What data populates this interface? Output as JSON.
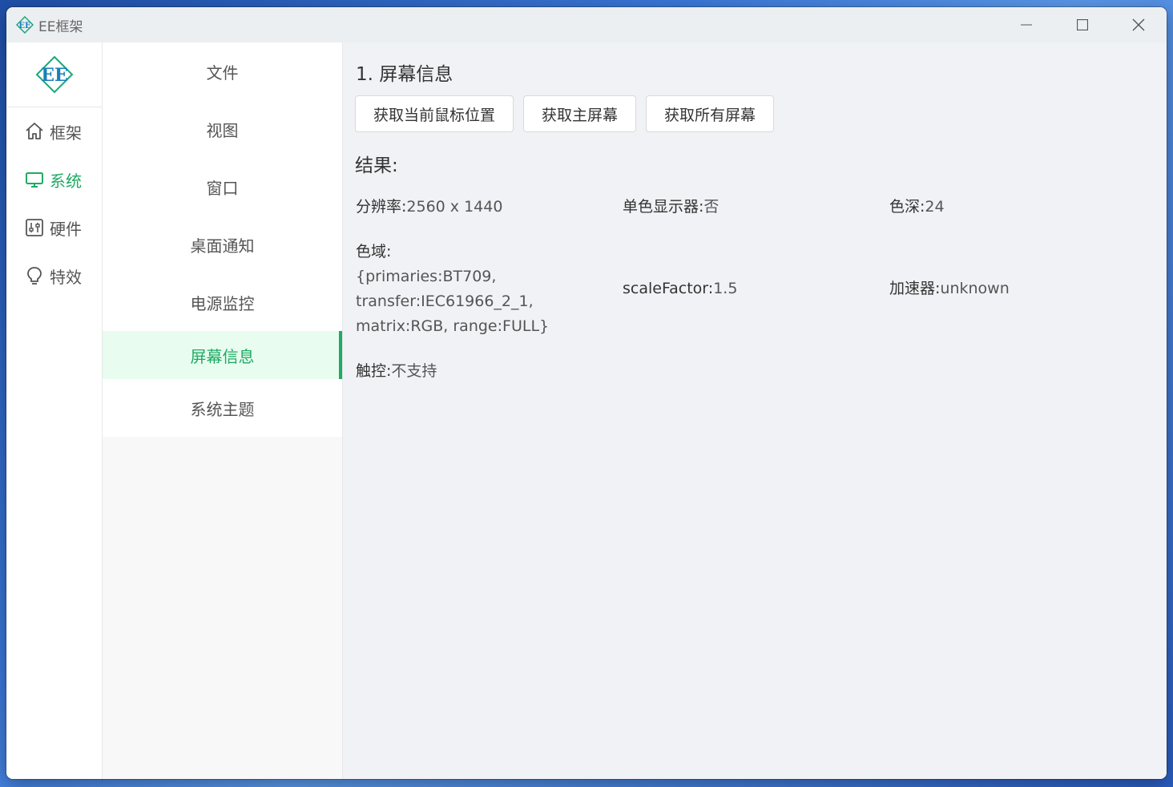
{
  "window": {
    "title": "EE框架",
    "controls": {
      "minimize": "—",
      "maximize": "☐",
      "close": "✕"
    }
  },
  "rail": {
    "items": [
      {
        "label": "框架",
        "icon": "home-icon",
        "active": false
      },
      {
        "label": "系统",
        "icon": "monitor-icon",
        "active": true
      },
      {
        "label": "硬件",
        "icon": "sliders-icon",
        "active": false
      },
      {
        "label": "特效",
        "icon": "bulb-icon",
        "active": false
      }
    ]
  },
  "submenu": {
    "items": [
      {
        "label": "文件"
      },
      {
        "label": "视图"
      },
      {
        "label": "窗口"
      },
      {
        "label": "桌面通知"
      },
      {
        "label": "电源监控"
      },
      {
        "label": "屏幕信息",
        "active": true
      },
      {
        "label": "系统主题"
      }
    ]
  },
  "content": {
    "section_title": "1. 屏幕信息",
    "buttons": {
      "cursor": "获取当前鼠标位置",
      "primary": "获取主屏幕",
      "all": "获取所有屏幕"
    },
    "result_label": "结果:",
    "info": {
      "resolution": {
        "key": "分辨率:",
        "value": "2560 x 1440"
      },
      "monochrome": {
        "key": "单色显示器:",
        "value": "否"
      },
      "color_depth": {
        "key": "色深:",
        "value": "24"
      },
      "color_space": {
        "key": "色域:",
        "line1": "{primaries:BT709,",
        "line2": "transfer:IEC61966_2_1,",
        "line3": "matrix:RGB, range:FULL}"
      },
      "scale_factor": {
        "key": "scaleFactor:",
        "value": "1.5"
      },
      "accelerometer": {
        "key": "加速器:",
        "value": "unknown"
      },
      "touch": {
        "key": "触控:",
        "value": "不支持"
      }
    }
  },
  "colors": {
    "accent": "#1eab63",
    "active_bg": "#e8fcef",
    "content_bg": "#f0f2f5"
  }
}
